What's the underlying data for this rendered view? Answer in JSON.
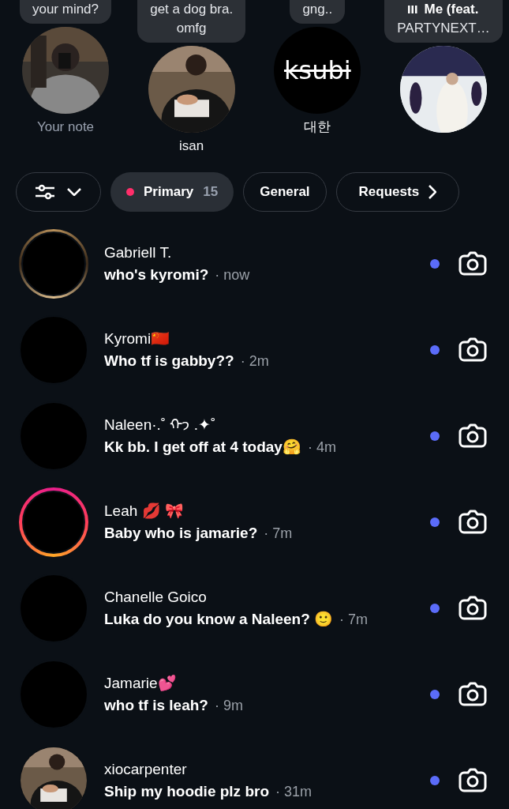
{
  "notes": [
    {
      "note_lines": [
        "your mind?"
      ],
      "label": "Your note",
      "muted_label": true,
      "music": false
    },
    {
      "note_lines": [
        "get a dog bra.",
        "omfg"
      ],
      "label": "isan",
      "muted_label": false,
      "music": false
    },
    {
      "note_lines": [
        "gng.."
      ],
      "label": "대한",
      "logo_text": "ksubi",
      "muted_label": false,
      "music": false
    },
    {
      "note_lines": [
        "Me (feat.",
        "PARTYNEXT…"
      ],
      "music": true
    }
  ],
  "filters": [
    {
      "kind": "menu",
      "selected": false
    },
    {
      "kind": "tab",
      "label": "Primary",
      "count": "15",
      "selected": true
    },
    {
      "kind": "tab",
      "label": "General",
      "selected": false
    },
    {
      "kind": "link",
      "label": "Requests",
      "selected": false
    }
  ],
  "chats": [
    {
      "name": "Gabriell T.",
      "message": "who's kyromi?",
      "time": "· now",
      "gold_ring": true,
      "story_ring": false,
      "unread": true
    },
    {
      "name": "Kyromi🇨🇳",
      "message": "Who tf is gabby??",
      "time": "· 2m",
      "gold_ring": false,
      "story_ring": false,
      "unread": true
    },
    {
      "name": "Naleen·.˚ ᡣ𐭩 .✦˚",
      "message": "Kk bb. I get off at 4 today🤗",
      "time": "· 4m",
      "gold_ring": false,
      "story_ring": false,
      "unread": true
    },
    {
      "name": "Leah 💋 🎀",
      "message": "Baby who is jamarie?",
      "time": "· 7m",
      "gold_ring": false,
      "story_ring": true,
      "unread": true
    },
    {
      "name": "Chanelle Goico",
      "message": "Luka do you know a Naleen? 🙂",
      "time": "· 7m",
      "gold_ring": false,
      "story_ring": false,
      "unread": true
    },
    {
      "name": "Jamarie💕",
      "message": "who tf is leah?",
      "time": "· 9m",
      "gold_ring": false,
      "story_ring": false,
      "unread": true
    },
    {
      "name": "xiocarpenter",
      "message": "Ship my hoodie plz bro",
      "time": "· 31m",
      "gold_ring": false,
      "story_ring": false,
      "unread": true
    }
  ]
}
